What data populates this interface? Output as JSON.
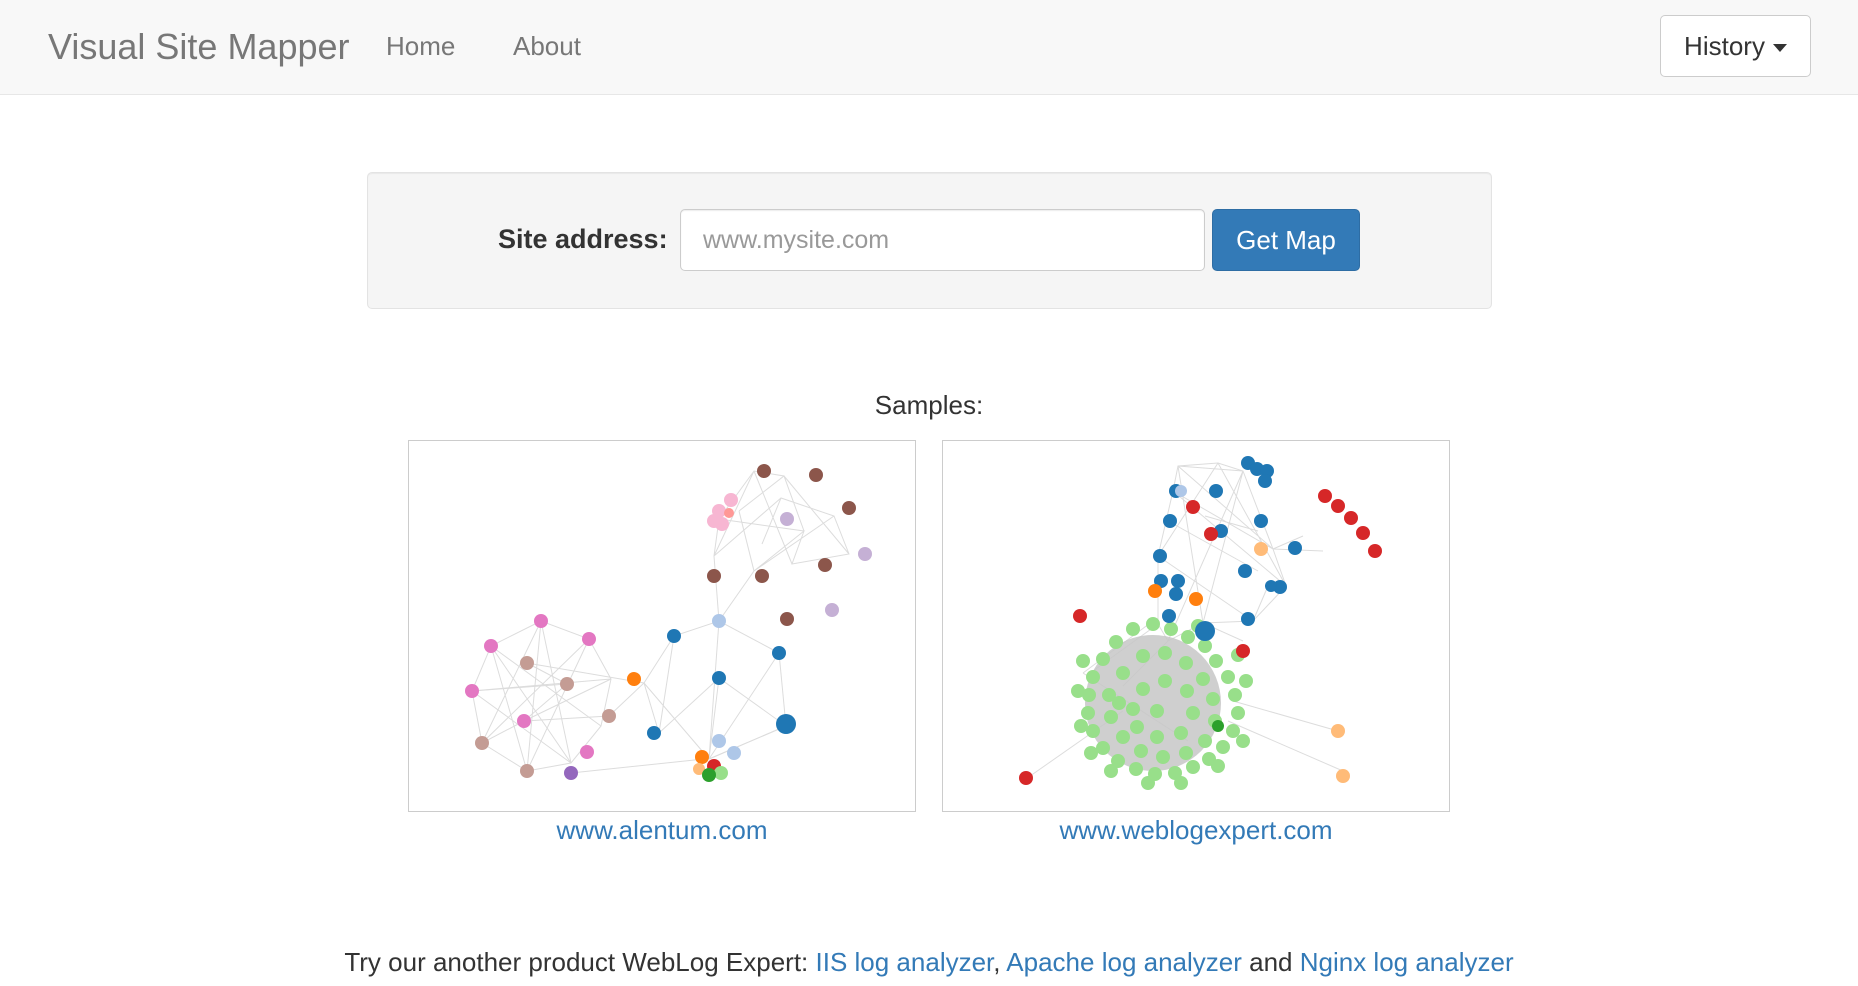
{
  "navbar": {
    "brand": "Visual Site Mapper",
    "links": [
      "Home",
      "About"
    ],
    "history_label": "History"
  },
  "form": {
    "label": "Site address:",
    "placeholder": "www.mysite.com",
    "value": "",
    "submit_label": "Get Map"
  },
  "samples": {
    "heading": "Samples:",
    "items": [
      {
        "link": "www.alentum.com",
        "image_kind": "site-graph-thumbnail"
      },
      {
        "link": "www.weblogexpert.com",
        "image_kind": "site-graph-thumbnail"
      }
    ]
  },
  "footer": {
    "prefix": "Try our another product WebLog Expert: ",
    "link1": "IIS log analyzer",
    "sep1": ", ",
    "link2": "Apache log analyzer",
    "sep2": " and ",
    "link3": "Nginx log analyzer"
  },
  "colors": {
    "link": "#337ab7",
    "primary_button": "#337ab7",
    "navbar_bg": "#f8f8f8",
    "well_bg": "#f5f5f5"
  },
  "icons": {
    "history_caret": "caret-down-icon"
  }
}
